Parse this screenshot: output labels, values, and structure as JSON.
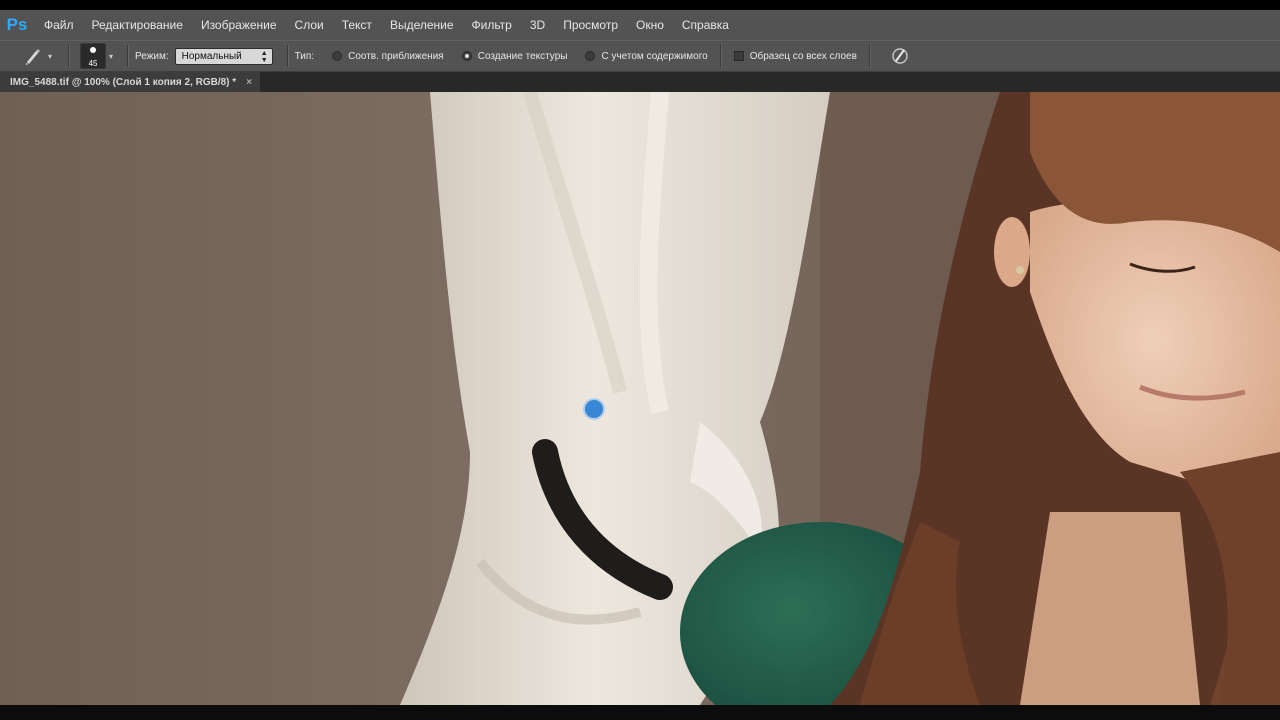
{
  "app": {
    "logo": "Ps"
  },
  "menu": [
    "Файл",
    "Редактирование",
    "Изображение",
    "Слои",
    "Текст",
    "Выделение",
    "Фильтр",
    "3D",
    "Просмотр",
    "Окно",
    "Справка"
  ],
  "options": {
    "tool_icon": "healing-brush-icon",
    "brush_size": "45",
    "mode_label": "Режим:",
    "mode_value": "Нормальный",
    "type_label": "Тип:",
    "type_options": [
      {
        "label": "Соотв. приближения",
        "checked": false
      },
      {
        "label": "Создание текстуры",
        "checked": true
      },
      {
        "label": "С учетом содержимого",
        "checked": false
      }
    ],
    "sample_all_label": "Образец со всех слоев",
    "sample_all_checked": false,
    "pressure_icon": "pressure-brush-icon"
  },
  "document": {
    "tab_title": "IMG_5488.tif @ 100% (Слой 1 копия 2, RGB/8) *",
    "close_glyph": "×"
  },
  "colors": {
    "panel": "#535353",
    "accent": "#31a8ff",
    "background_wall": "#76665b",
    "curtain": "#e4ddd3",
    "sweater": "#1f5a45"
  }
}
